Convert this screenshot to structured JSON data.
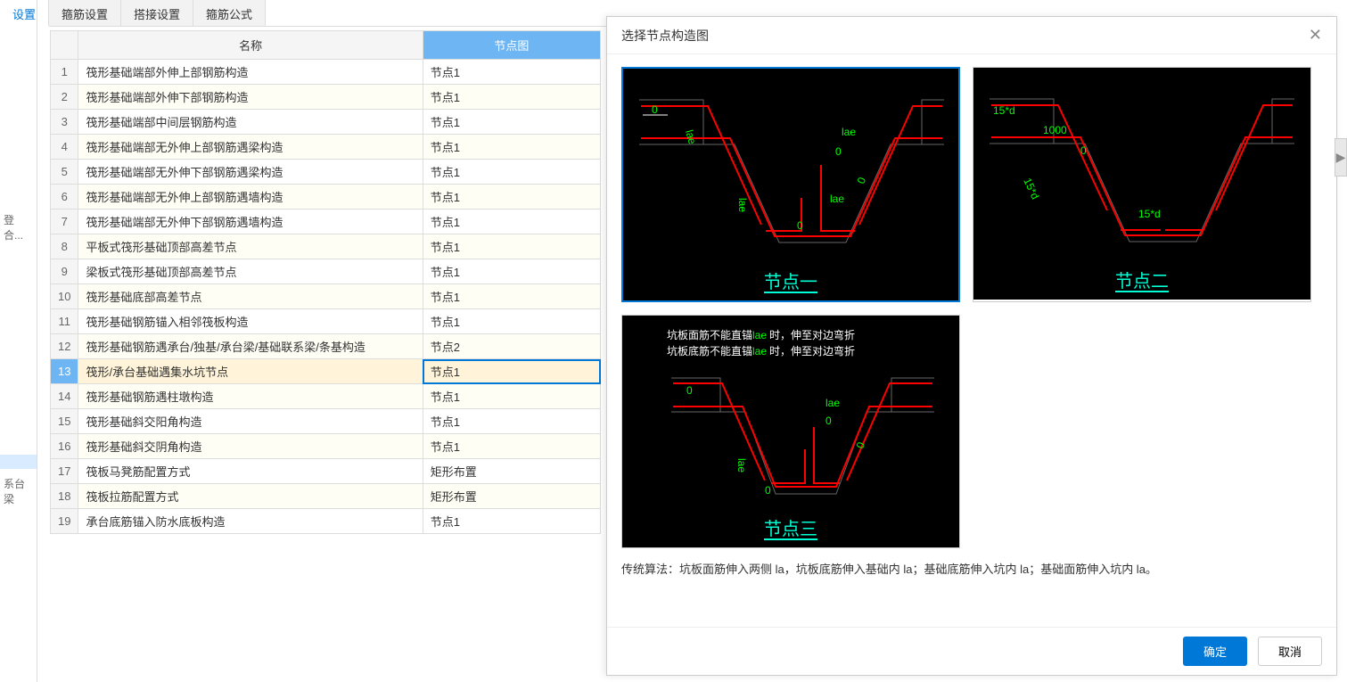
{
  "tabs": [
    {
      "label": "设置",
      "active": true
    },
    {
      "label": "箍筋设置"
    },
    {
      "label": "搭接设置"
    },
    {
      "label": "箍筋公式"
    }
  ],
  "left_items": [
    {
      "label": "登合...",
      "active": false
    },
    {
      "label": "系台梁",
      "active": false
    }
  ],
  "left_active_placeholder": " ",
  "table": {
    "headers": {
      "name": "名称",
      "node": "节点图"
    },
    "rows": [
      {
        "n": 1,
        "name": "筏形基础端部外伸上部钢筋构造",
        "node": "节点1"
      },
      {
        "n": 2,
        "name": "筏形基础端部外伸下部钢筋构造",
        "node": "节点1"
      },
      {
        "n": 3,
        "name": "筏形基础端部中间层钢筋构造",
        "node": "节点1"
      },
      {
        "n": 4,
        "name": "筏形基础端部无外伸上部钢筋遇梁构造",
        "node": "节点1"
      },
      {
        "n": 5,
        "name": "筏形基础端部无外伸下部钢筋遇梁构造",
        "node": "节点1"
      },
      {
        "n": 6,
        "name": "筏形基础端部无外伸上部钢筋遇墙构造",
        "node": "节点1"
      },
      {
        "n": 7,
        "name": "筏形基础端部无外伸下部钢筋遇墙构造",
        "node": "节点1"
      },
      {
        "n": 8,
        "name": "平板式筏形基础顶部高差节点",
        "node": "节点1"
      },
      {
        "n": 9,
        "name": "梁板式筏形基础顶部高差节点",
        "node": "节点1"
      },
      {
        "n": 10,
        "name": "筏形基础底部高差节点",
        "node": "节点1"
      },
      {
        "n": 11,
        "name": "筏形基础钢筋锚入相邻筏板构造",
        "node": "节点1"
      },
      {
        "n": 12,
        "name": "筏形基础钢筋遇承台/独基/承台梁/基础联系梁/条基构造",
        "node": "节点2"
      },
      {
        "n": 13,
        "name": "筏形/承台基础遇集水坑节点",
        "node": "节点1",
        "selected": true
      },
      {
        "n": 14,
        "name": "筏形基础钢筋遇柱墩构造",
        "node": "节点1"
      },
      {
        "n": 15,
        "name": "筏形基础斜交阳角构造",
        "node": "节点1"
      },
      {
        "n": 16,
        "name": "筏形基础斜交阴角构造",
        "node": "节点1"
      },
      {
        "n": 17,
        "name": "筏板马凳筋配置方式",
        "node": "矩形布置"
      },
      {
        "n": 18,
        "name": "筏板拉筋配置方式",
        "node": "矩形布置"
      },
      {
        "n": 19,
        "name": "承台底筋锚入防水底板构造",
        "node": "节点1"
      }
    ]
  },
  "modal": {
    "title": "选择节点构造图",
    "diagrams": [
      {
        "caption": "节点一",
        "selected": true,
        "labels": {
          "a": "0",
          "b": "lae",
          "c": "lae",
          "d": "0",
          "e": "lae",
          "f": "0",
          "g": "lae",
          "h": "0"
        }
      },
      {
        "caption": "节点二",
        "labels": {
          "a": "15*d",
          "b": "1000",
          "c": "0",
          "d": "15*d",
          "e": "15*d"
        }
      },
      {
        "caption": "节点三",
        "labels": {
          "a": "0",
          "b": "lae",
          "c": "0",
          "d": "lae",
          "e": "0",
          "f": "0"
        },
        "notes": {
          "line1_pre": "坑板面筋不能直锚",
          "line1_green": "lae",
          "line1_post": " 时，伸至对边弯折",
          "line2_pre": "坑板底筋不能直锚",
          "line2_green": "lae",
          "line2_post": " 时，伸至对边弯折"
        }
      }
    ],
    "desc": "传统算法：坑板面筋伸入两侧 la，坑板底筋伸入基础内 la；基础底筋伸入坑内 la；基础面筋伸入坑内 la。",
    "ok": "确定",
    "cancel": "取消"
  }
}
